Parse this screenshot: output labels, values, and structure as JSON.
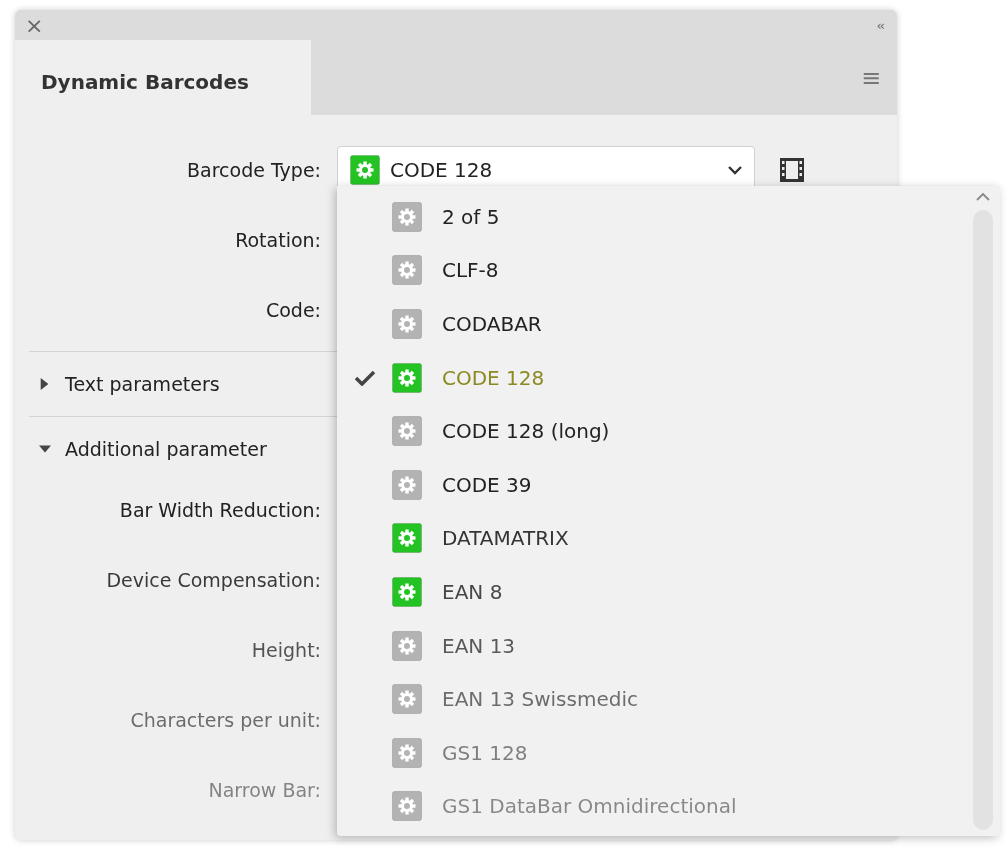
{
  "panel": {
    "close": "×",
    "collapse": "‹‹",
    "tab": "Dynamic Barcodes",
    "menu": "≡"
  },
  "form": {
    "barcode_type": {
      "label": "Barcode Type:",
      "value": "CODE 128",
      "color": "#22c322"
    },
    "fields": [
      {
        "label": "Rotation:"
      },
      {
        "label": "Code:"
      }
    ],
    "sections": [
      {
        "label": "Text parameters",
        "expanded": false
      },
      {
        "label": "Additional parameter",
        "expanded": true
      }
    ],
    "additional": [
      {
        "label": "Bar Width Reduction:"
      },
      {
        "label": "Device Compensation:"
      },
      {
        "label": "Height:"
      },
      {
        "label": "Characters per unit:"
      },
      {
        "label": "Narrow Bar:"
      }
    ]
  },
  "dropdown": {
    "items": [
      {
        "label": "2 of 5",
        "selected": false,
        "color": "#b3b3b3"
      },
      {
        "label": "CLF-8",
        "selected": false,
        "color": "#b3b3b3"
      },
      {
        "label": "CODABAR",
        "selected": false,
        "color": "#b3b3b3"
      },
      {
        "label": "CODE 128",
        "selected": true,
        "color": "#22c322"
      },
      {
        "label": "CODE 128 (long)",
        "selected": false,
        "color": "#b3b3b3"
      },
      {
        "label": "CODE 39",
        "selected": false,
        "color": "#b3b3b3"
      },
      {
        "label": "DATAMATRIX",
        "selected": false,
        "color": "#22c322"
      },
      {
        "label": "EAN 8",
        "selected": false,
        "color": "#22c322"
      },
      {
        "label": "EAN 13",
        "selected": false,
        "color": "#b3b3b3"
      },
      {
        "label": "EAN 13 Swissmedic",
        "selected": false,
        "color": "#b3b3b3"
      },
      {
        "label": "GS1 128",
        "selected": false,
        "color": "#b3b3b3"
      },
      {
        "label": "GS1 DataBar Omnidirectional",
        "selected": false,
        "color": "#b3b3b3"
      }
    ]
  }
}
